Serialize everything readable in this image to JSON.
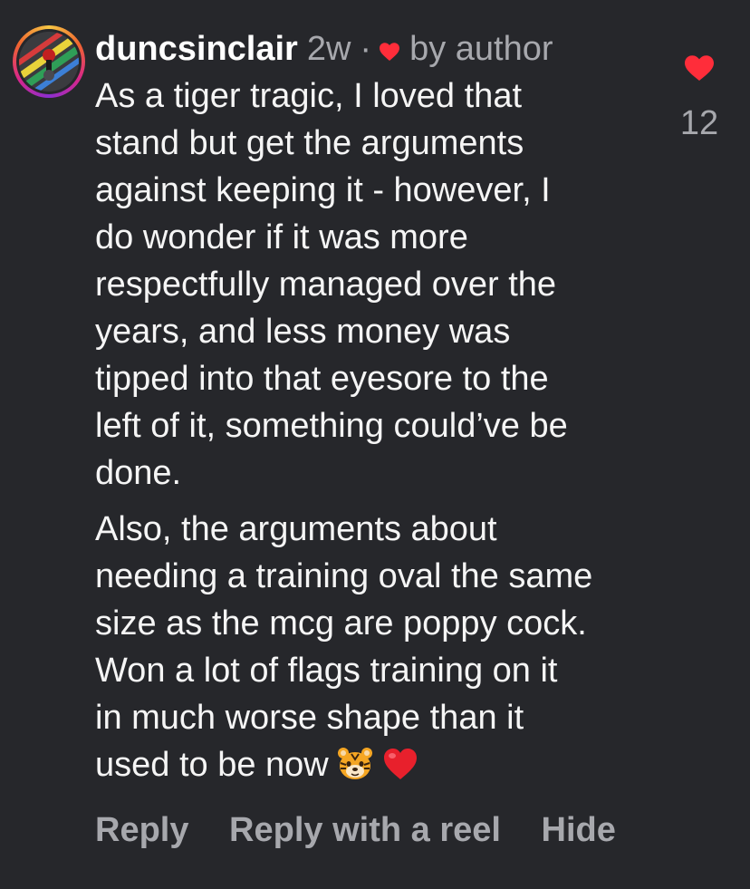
{
  "comment": {
    "username": "duncsinclair",
    "time": "2w",
    "separator": "·",
    "liked_by": "by author",
    "paragraphs": [
      "As a tiger tragic, I loved that\nstand but get the arguments\nagainst keeping it - however, I\ndo wonder if it was more\nrespectfully managed over the\nyears, and less money was\ntipped into that eyesore to the\nleft of it, something could’ve be\ndone.",
      "Also, the arguments about\nneeding a training oval the same\nsize as the mcg are poppy cock.\nWon a lot of flags training on it\nin much worse shape than it\nused to be now"
    ],
    "trailing_emojis": [
      "tiger-face-icon",
      "red-heart-icon"
    ],
    "like_count": "12"
  },
  "actions": {
    "reply": "Reply",
    "reply_reel": "Reply with a reel",
    "hide": "Hide"
  },
  "colors": {
    "background": "#26272b",
    "text": "#f5f5f5",
    "muted": "#a7a8ad",
    "like_red": "#ff2d3a"
  }
}
